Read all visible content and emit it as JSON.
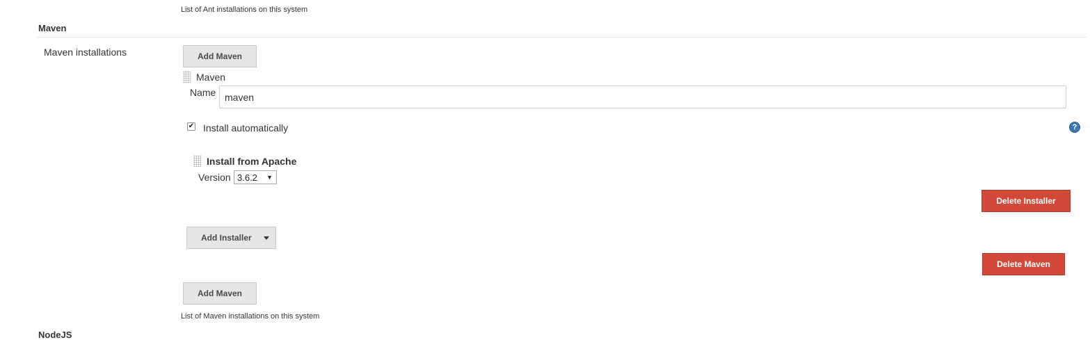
{
  "ant": {
    "description": "List of Ant installations on this system"
  },
  "maven": {
    "section_title": "Maven",
    "installations_label": "Maven installations",
    "add_maven_top": "Add Maven",
    "entry": {
      "header": "Maven",
      "name_label": "Name",
      "name_value": "maven",
      "install_automatically_label": "Install automatically",
      "install_automatically_checked": true,
      "help_icon": "question-icon",
      "installer": {
        "title": "Install from Apache",
        "version_label": "Version",
        "version_selected": "3.6.2",
        "delete_installer": "Delete Installer"
      },
      "add_installer": "Add Installer",
      "delete_maven": "Delete Maven"
    },
    "add_maven_bottom": "Add Maven",
    "description": "List of Maven installations on this system"
  },
  "nodejs": {
    "section_title": "NodeJS"
  },
  "colors": {
    "danger": "#d24939",
    "button_gray": "#e6e6e6",
    "help_blue": "#3a79b4"
  }
}
